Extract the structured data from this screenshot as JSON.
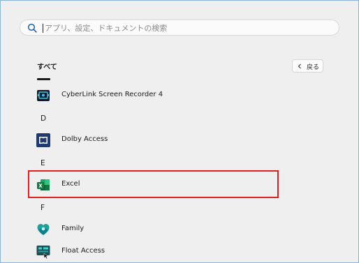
{
  "search": {
    "placeholder": "アプリ、設定、ドキュメントの検索",
    "value": ""
  },
  "section": {
    "title": "すべて",
    "back_label": "戻る"
  },
  "letters": {
    "d": "D",
    "e": "E",
    "f": "F"
  },
  "apps": [
    {
      "label": "CyberLink Screen Recorder 4",
      "icon": "cyberlink-recorder-icon"
    },
    {
      "label": "Dolby Access",
      "icon": "dolby-icon"
    },
    {
      "label": "Excel",
      "icon": "excel-icon"
    },
    {
      "label": "Family",
      "icon": "family-icon"
    },
    {
      "label": "Float Access",
      "icon": "float-access-icon"
    }
  ],
  "colors": {
    "highlight": "#e02020",
    "excel_green": "#1f7244",
    "dolby_blue": "#1e3a6e",
    "family_teal": "#1aa39a"
  }
}
